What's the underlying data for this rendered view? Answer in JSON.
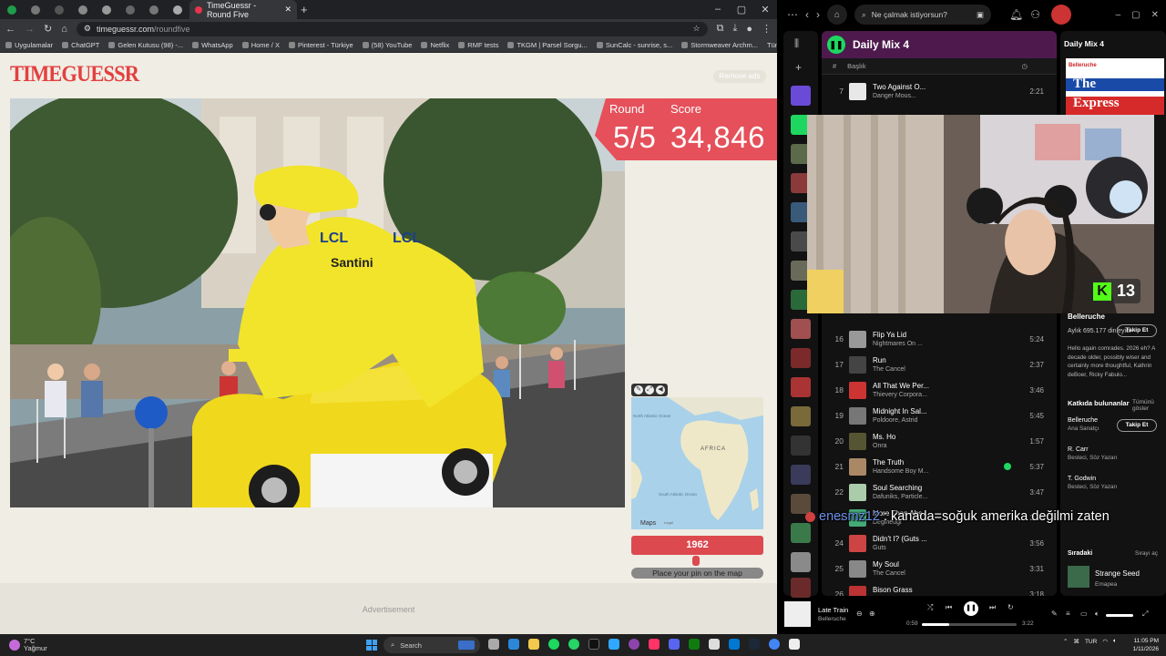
{
  "browser": {
    "active_tab_title": "TimeGuessr - Round Five",
    "url_host": "timeguessr.com",
    "url_path": "/roundfive",
    "bookmarks": [
      "Uygulamalar",
      "ChatGPT",
      "Gelen Kutusu (98) -...",
      "WhatsApp",
      "Home / X",
      "Pinterest - Türkiye",
      "(58) YouTube",
      "Netflix",
      "RMF tests",
      "TKGM | Parsel Sorgu...",
      "SunCalc - sunrise, s...",
      "Stormweaver Archm..."
    ],
    "all_bookmarks_label": "Tüm Yer İşaretleri"
  },
  "game": {
    "logo": "TIMEGUESSR",
    "remove_ads": "Remove ads",
    "round_label": "Round",
    "score_label": "Score",
    "round_value": "5/5",
    "score_value": "34,846",
    "year": "1962",
    "year_slider_fraction": 0.49,
    "place_pin": "Place your pin on the map",
    "advertisement": "Advertisement",
    "map_labels": {
      "north_atlantic": "North Atlantic Ocean",
      "africa": "AFRICA",
      "south_atlantic": "South Atlantic Ocean",
      "maps": "Maps",
      "legal": "Legal"
    },
    "photo_texts": {
      "lcl": "LCL",
      "santini": "Santini"
    }
  },
  "spotify": {
    "search_placeholder": "Ne çalmak istiyorsun?",
    "playlist_title": "Daily Mix 4",
    "col_title": "Başlık",
    "tracks": [
      {
        "num": "7",
        "title": "Two Against O...",
        "artist": "Danger Mous...",
        "duration": "2:21",
        "saved": false
      },
      {
        "num": "16",
        "title": "Flip Ya Lid",
        "artist": "Nightmares On ...",
        "duration": "5:24",
        "saved": false
      },
      {
        "num": "17",
        "title": "Run",
        "artist": "The Cancel",
        "duration": "2:37",
        "saved": false
      },
      {
        "num": "18",
        "title": "All That We Per...",
        "artist": "Thievery Corpora...",
        "duration": "3:46",
        "saved": false
      },
      {
        "num": "19",
        "title": "Midnight In Sal...",
        "artist": "Poldoore, Astrid",
        "duration": "5:45",
        "saved": false
      },
      {
        "num": "20",
        "title": "Ms. Ho",
        "artist": "Onra",
        "duration": "1:57",
        "saved": false
      },
      {
        "num": "21",
        "title": "The Truth",
        "artist": "Handsome Boy M...",
        "duration": "5:37",
        "saved": true
      },
      {
        "num": "22",
        "title": "Soul Searching",
        "artist": "Dafuniks, Particle...",
        "duration": "3:47",
        "saved": false
      },
      {
        "num": "23",
        "title": "More Than Abs...",
        "artist": "Degiheugi",
        "duration": "3:10",
        "saved": false
      },
      {
        "num": "24",
        "title": "Didn't I? (Guts ...",
        "artist": "Guts",
        "duration": "3:56",
        "saved": false
      },
      {
        "num": "25",
        "title": "My Soul",
        "artist": "The Cancel",
        "duration": "3:31",
        "saved": false
      },
      {
        "num": "26",
        "title": "Bison Grass",
        "artist": "Poldoore",
        "duration": "3:18",
        "saved": false
      }
    ],
    "right": {
      "title": "Daily Mix 4",
      "cover_brand": "Belleruche",
      "cover_text1": "The",
      "cover_text2": "Express",
      "artist": "Belleruche",
      "listeners": "Aylık 695.177 dinleyici",
      "follow": "Takip Et",
      "bio": "Hello again comrades. 2026 eh? A decade older, possibly wiser and certainly more thoughtful, Kathrin deBoer, Ricky Fabulo...",
      "contributors_title": "Katkıda bulunanlar",
      "show_all": "Tümünü göster",
      "contributors": [
        {
          "name": "Belleruche",
          "role": "Ana Sanatçı"
        },
        {
          "name": "R. Carr",
          "role": "Besteci, Söz Yazarı"
        },
        {
          "name": "T. Godwin",
          "role": "Besteci, Söz Yazarı"
        }
      ],
      "next_title": "Sıradaki",
      "open_queue": "Sırayı aç",
      "next_song": "Strange Seed",
      "next_artist": "Emapea"
    },
    "now_playing": {
      "title": "Late Train",
      "artist": "Belleruche",
      "elapsed": "0:59",
      "total": "3:22",
      "progress_fraction": 0.29
    }
  },
  "stream": {
    "viewers": "13",
    "chat_user": "enesmz12",
    "chat_message": ": kanada=soğuk amerika değilmi zaten"
  },
  "taskbar": {
    "temp": "7°C",
    "weather": "Yağmur",
    "search": "Search",
    "lang": "TUR",
    "time": "11:05 PM",
    "date": "1/11/2026"
  }
}
